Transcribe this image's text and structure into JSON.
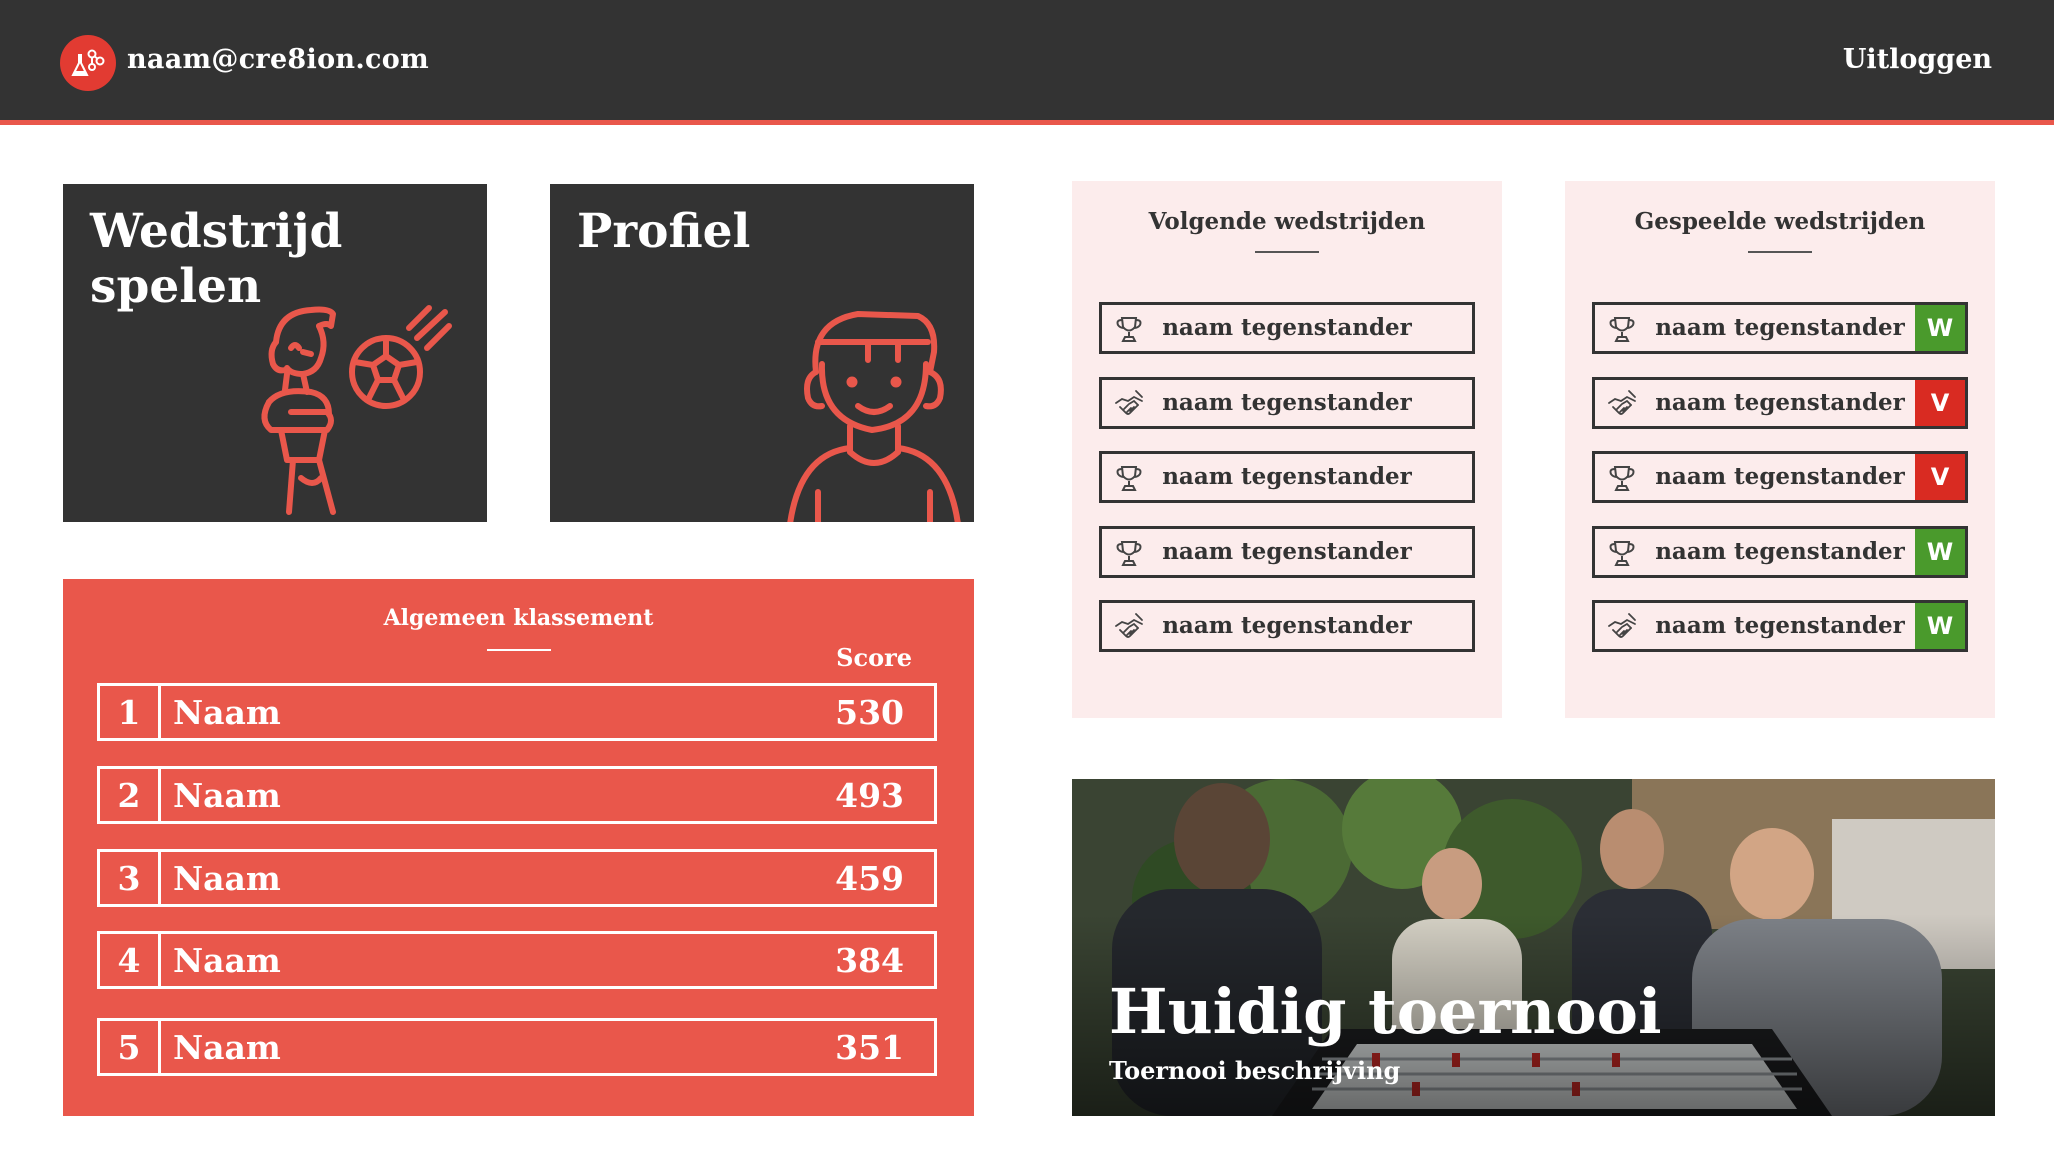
{
  "header": {
    "email": "naam@cre8ion.com",
    "logout_label": "Uitloggen"
  },
  "tiles": {
    "play_title": "Wedstrijd\nspelen",
    "profile_title": "Profiel"
  },
  "ranking": {
    "title": "Algemeen klassement",
    "score_header": "Score",
    "rows": [
      {
        "rank": "1",
        "name": "Naam",
        "score": "530"
      },
      {
        "rank": "2",
        "name": "Naam",
        "score": "493"
      },
      {
        "rank": "3",
        "name": "Naam",
        "score": "459"
      },
      {
        "rank": "4",
        "name": "Naam",
        "score": "384"
      },
      {
        "rank": "5",
        "name": "Naam",
        "score": "351"
      }
    ]
  },
  "upcoming": {
    "title": "Volgende wedstrijden",
    "matches": [
      {
        "icon": "trophy-icon",
        "opponent": "naam tegenstander"
      },
      {
        "icon": "handshake-icon",
        "opponent": "naam tegenstander"
      },
      {
        "icon": "trophy-icon",
        "opponent": "naam tegenstander"
      },
      {
        "icon": "trophy-icon",
        "opponent": "naam tegenstander"
      },
      {
        "icon": "handshake-icon",
        "opponent": "naam tegenstander"
      }
    ]
  },
  "played": {
    "title": "Gespeelde wedstrijden",
    "matches": [
      {
        "icon": "trophy-icon",
        "opponent": "naam tegenstander",
        "result": "W"
      },
      {
        "icon": "handshake-icon",
        "opponent": "naam tegenstander",
        "result": "V"
      },
      {
        "icon": "trophy-icon",
        "opponent": "naam tegenstander",
        "result": "V"
      },
      {
        "icon": "trophy-icon",
        "opponent": "naam tegenstander",
        "result": "W"
      },
      {
        "icon": "handshake-icon",
        "opponent": "naam tegenstander",
        "result": "W"
      }
    ]
  },
  "tournament": {
    "title": "Huidig toernooi",
    "description": "Toernooi beschrijving"
  },
  "colors": {
    "header_bg": "#333333",
    "accent": "#e9574b",
    "panel_bg": "#fcecec",
    "win": "#4a9a2c",
    "loss": "#d92b22"
  }
}
